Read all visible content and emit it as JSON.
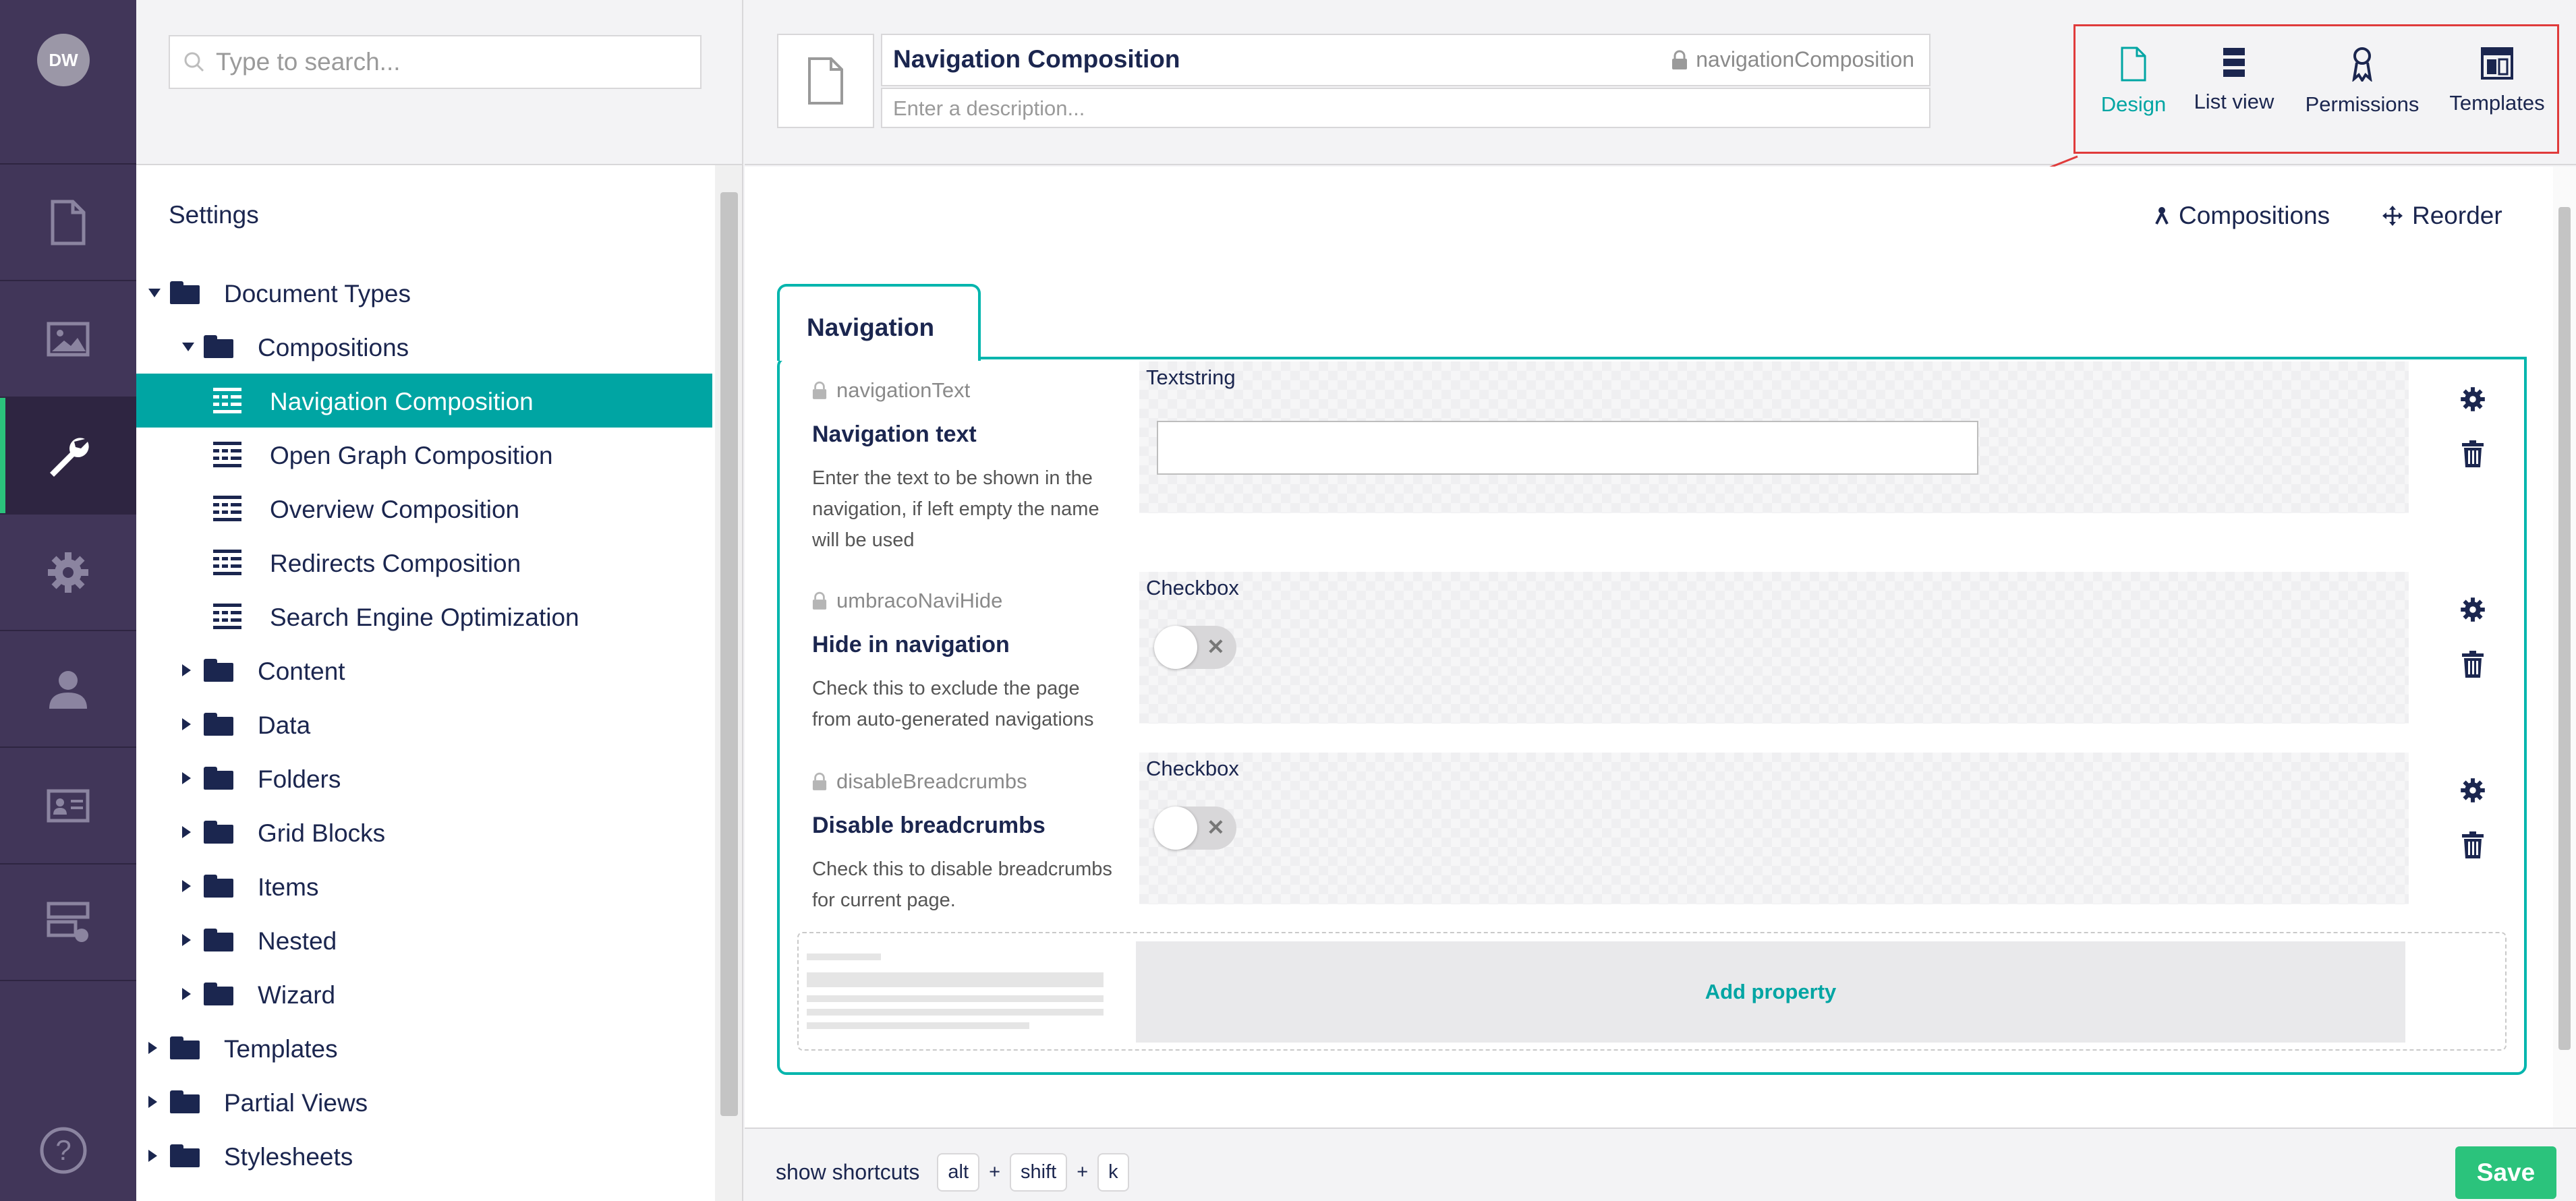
{
  "user": {
    "initials": "DW"
  },
  "leftnav": {
    "sections": [
      {
        "name": "content",
        "icon": "document-icon",
        "active": false
      },
      {
        "name": "media",
        "icon": "image-icon",
        "active": false
      },
      {
        "name": "settings",
        "icon": "wrench-icon",
        "active": true
      },
      {
        "name": "packages",
        "icon": "gear-icon",
        "active": false
      },
      {
        "name": "users",
        "icon": "user-icon",
        "active": false
      },
      {
        "name": "members",
        "icon": "id-card-icon",
        "active": false
      },
      {
        "name": "forms",
        "icon": "forms-icon",
        "active": false
      }
    ],
    "help_icon": "help-icon"
  },
  "tree": {
    "search_placeholder": "Type to search...",
    "title": "Settings",
    "items": [
      {
        "label": "Document Types",
        "type": "folder",
        "expanded": true
      },
      {
        "label": "Compositions",
        "type": "folder",
        "expanded": true
      },
      {
        "label": "Navigation Composition",
        "type": "doctype",
        "selected": true
      },
      {
        "label": "Open Graph Composition",
        "type": "doctype"
      },
      {
        "label": "Overview Composition",
        "type": "doctype"
      },
      {
        "label": "Redirects Composition",
        "type": "doctype"
      },
      {
        "label": "Search Engine Optimization",
        "type": "doctype"
      },
      {
        "label": "Content",
        "type": "folder",
        "expanded": false
      },
      {
        "label": "Data",
        "type": "folder",
        "expanded": false
      },
      {
        "label": "Folders",
        "type": "folder",
        "expanded": false
      },
      {
        "label": "Grid Blocks",
        "type": "folder",
        "expanded": false
      },
      {
        "label": "Items",
        "type": "folder",
        "expanded": false
      },
      {
        "label": "Nested",
        "type": "folder",
        "expanded": false
      },
      {
        "label": "Wizard",
        "type": "folder",
        "expanded": false
      },
      {
        "label": "Templates",
        "type": "folder",
        "expanded": false
      },
      {
        "label": "Partial Views",
        "type": "folder",
        "expanded": false
      },
      {
        "label": "Stylesheets",
        "type": "folder",
        "expanded": false
      }
    ]
  },
  "header": {
    "name": "Navigation Composition",
    "alias": "navigationComposition",
    "description_placeholder": "Enter a description...",
    "apps": [
      {
        "label": "Design",
        "icon": "document-icon",
        "active": true
      },
      {
        "label": "List view",
        "icon": "list-icon",
        "active": false
      },
      {
        "label": "Permissions",
        "icon": "permissions-icon",
        "active": false
      },
      {
        "label": "Templates",
        "icon": "template-icon",
        "active": false
      }
    ]
  },
  "toolbar": {
    "compositions_label": "Compositions",
    "reorder_label": "Reorder"
  },
  "group": {
    "name": "Navigation",
    "properties": [
      {
        "alias": "navigationText",
        "name": "Navigation text",
        "description": "Enter the text to be shown in the navigation, if left empty the name will be used",
        "editor": "Textstring",
        "kind": "text",
        "value": ""
      },
      {
        "alias": "umbracoNaviHide",
        "name": "Hide in navigation",
        "description": "Check this to exclude the page from auto-generated navigations",
        "editor": "Checkbox",
        "kind": "toggle",
        "value": false
      },
      {
        "alias": "disableBreadcrumbs",
        "name": "Disable breadcrumbs",
        "description": "Check this to disable breadcrumbs for current page.",
        "editor": "Checkbox",
        "kind": "toggle",
        "value": false
      }
    ],
    "add_property_label": "Add property"
  },
  "footer": {
    "shortcuts_label": "show shortcuts",
    "keys": [
      "alt",
      "shift",
      "k"
    ],
    "save_label": "Save"
  },
  "colors": {
    "nav_bg": "#413659",
    "accent": "#00a5a3",
    "save": "#2bc37c",
    "highlight": "#e03b3b"
  }
}
